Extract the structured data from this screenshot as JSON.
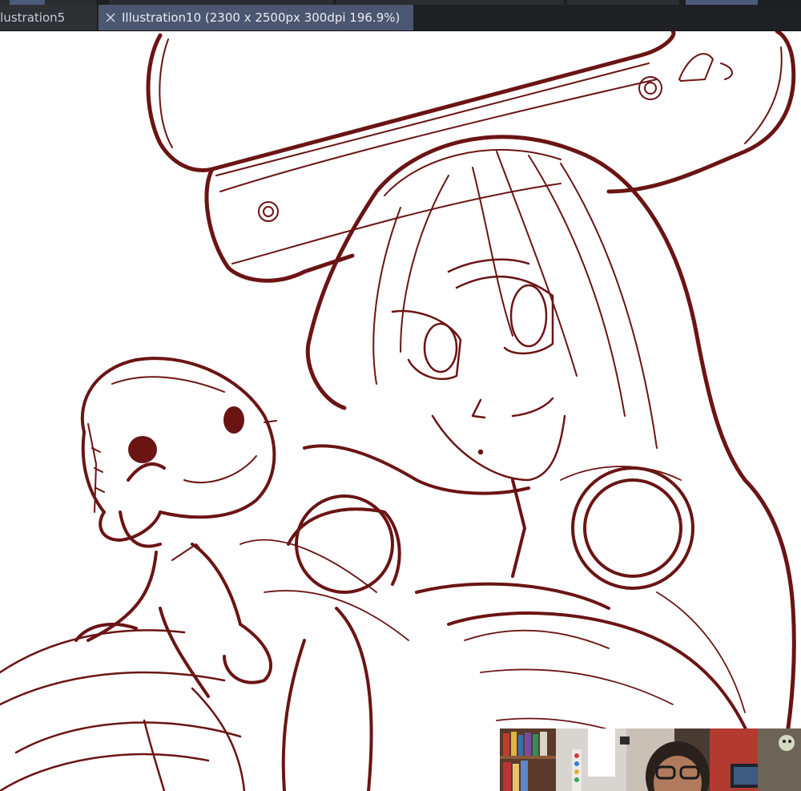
{
  "tabs": [
    {
      "label": "llustration5",
      "active": false
    },
    {
      "label": "Illustration10 (2300 x 2500px 300dpi 196.9%)",
      "active": true
    }
  ],
  "colors": {
    "ink": "#6b1414",
    "tab_active": "#4b5670",
    "tab_inactive": "#2f3034",
    "tabbar": "#2a2b2f",
    "canvas": "#ffffff"
  },
  "icons": {
    "tab_close": "close-icon"
  }
}
